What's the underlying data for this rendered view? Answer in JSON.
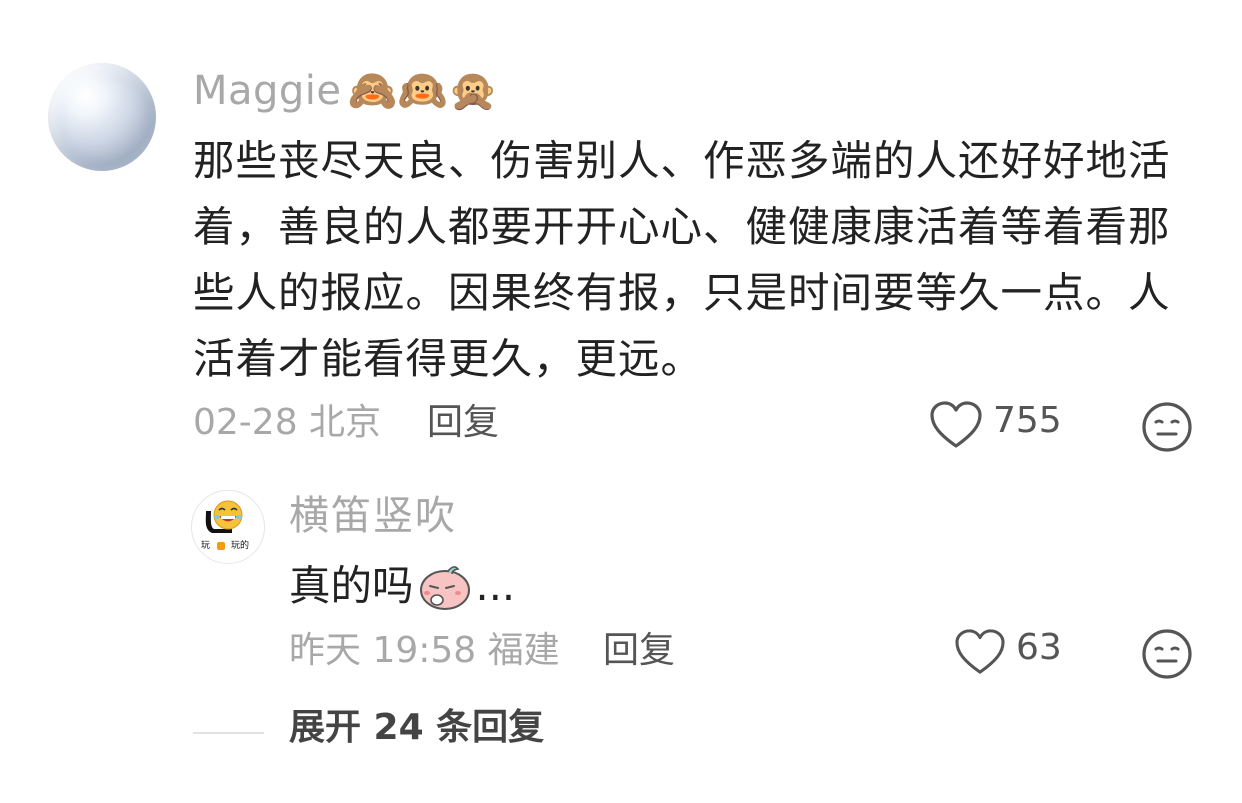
{
  "comment": {
    "username": "Maggie",
    "username_emojis": "🙈🙉🙊",
    "text": "那些丧尽天良、伤害别人、作恶多端的人还好好地活着，善良的人都要开开心心、健健康康活着等着看那些人的报应。因果终有报，只是时间要等久一点。人活着才能看得更久，更远。",
    "meta": "02-28 北京",
    "reply_label": "回复",
    "like_count": "755"
  },
  "reply": {
    "username": "横笛竖吹",
    "avatar_caption_left": "玩",
    "avatar_caption_right": "玩的",
    "text": "真的吗",
    "text_suffix": "...",
    "meta": "昨天 19:58 福建",
    "reply_label": "回复",
    "like_count": "63"
  },
  "expand": {
    "label": "展开 24 条回复"
  },
  "colors": {
    "muted": "#a8a8a8",
    "body": "#222222",
    "action": "#555555"
  }
}
